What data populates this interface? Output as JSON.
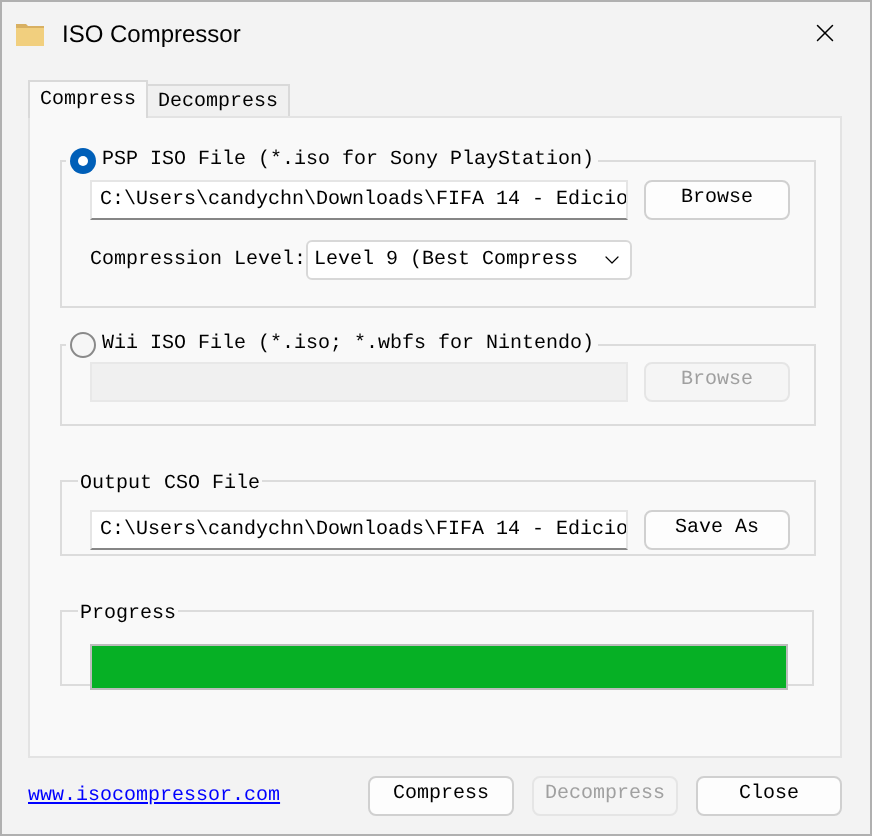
{
  "window": {
    "title": "ISO Compressor"
  },
  "tabs": [
    {
      "label": "Compress",
      "selected": true
    },
    {
      "label": "Decompress",
      "selected": false
    }
  ],
  "psp_group": {
    "label": "PSP ISO File (*.iso for Sony PlayStation)",
    "selected": true,
    "enabled": true,
    "path": "C:\\Users\\candychn\\Downloads\\FIFA 14 - Edicio",
    "browse_button": "Browse",
    "compression_label": "Compression Level:",
    "compression_value": "Level 9 (Best Compress"
  },
  "wii_group": {
    "label": "Wii ISO File (*.iso; *.wbfs for Nintendo)",
    "selected": false,
    "enabled": false,
    "browse_button": "Browse"
  },
  "output_group": {
    "label": "Output CSO File",
    "path": "C:\\Users\\candychn\\Downloads\\FIFA 14 - Edicio",
    "save_button": "Save As"
  },
  "progress": {
    "label": "Progress",
    "level": 1
  },
  "link": "www.isocompressor.com",
  "buttons": [
    {
      "label": "Compress",
      "disabled": false
    },
    {
      "label": "Decompress",
      "disabled": true
    },
    {
      "label": "Close",
      "disabled": false
    }
  ]
}
